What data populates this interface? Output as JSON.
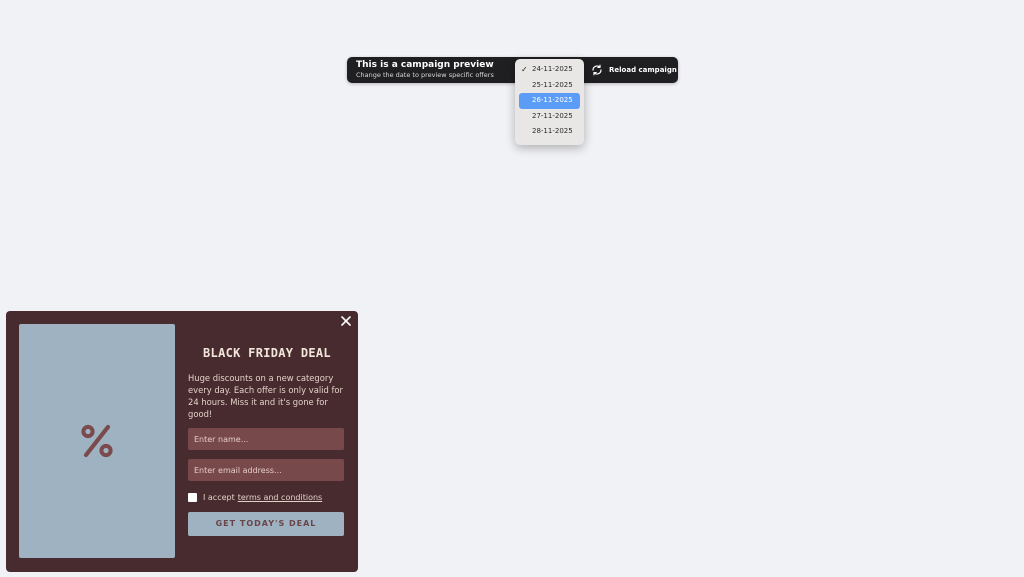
{
  "preview_bar": {
    "title": "This is a campaign preview",
    "subtitle": "Change the date to preview specific offers",
    "reload_label": "Reload campaign",
    "reload_icon": "refresh-icon"
  },
  "date_dropdown": {
    "selected": "24-11-2025",
    "highlighted": "26-11-2025",
    "options": [
      "24-11-2025",
      "25-11-2025",
      "26-11-2025",
      "27-11-2025",
      "28-11-2025"
    ],
    "check_glyph": "✓",
    "highlight_color": "#5b9cf6"
  },
  "popup": {
    "background_color": "#472b2f",
    "image_color": "#9eb2c1",
    "image_icon": "percent-icon",
    "close_icon": "close-icon",
    "heading": "BLACK FRIDAY DEAL",
    "description": "Huge discounts on a new category every day. Each offer is only valid for 24 hours. Miss it and it's gone for good!",
    "name_placeholder": "Enter name...",
    "email_placeholder": "Enter email address...",
    "terms_prefix": "I accept",
    "terms_link": "terms and conditions",
    "terms_checked": false,
    "cta_label": "GET TODAY'S DEAL"
  }
}
